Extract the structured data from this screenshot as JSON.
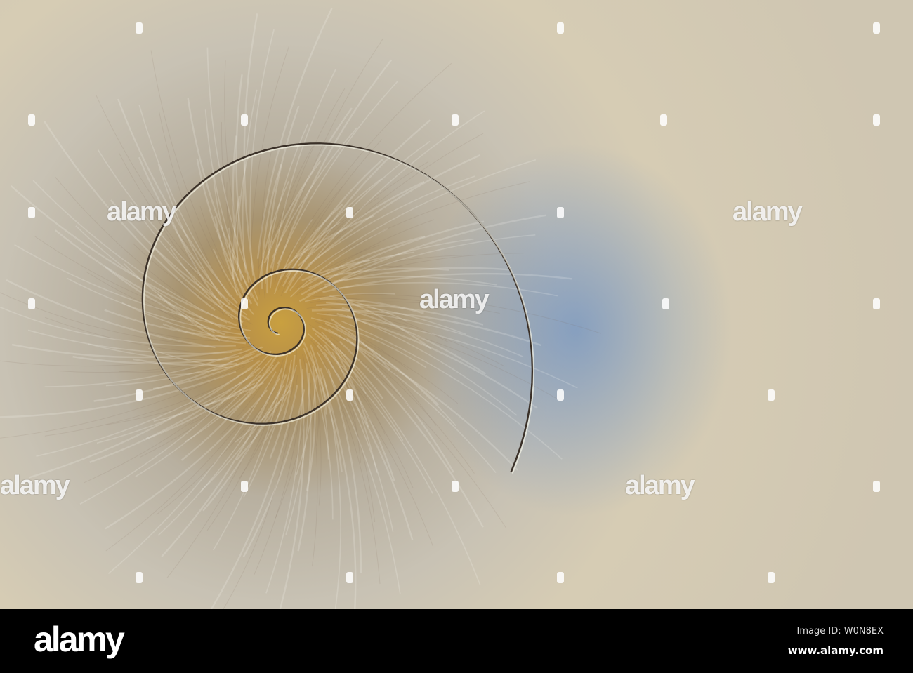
{
  "watermark": {
    "text": "alamy"
  },
  "footer": {
    "logo": "alamy",
    "image_id": "Image ID: W0N8EX",
    "url": "www.alamy.com"
  },
  "colors": {
    "core": "#c9a040",
    "blue": "#5082c8",
    "outer": "#d6ccb4",
    "footer": "#000000"
  }
}
